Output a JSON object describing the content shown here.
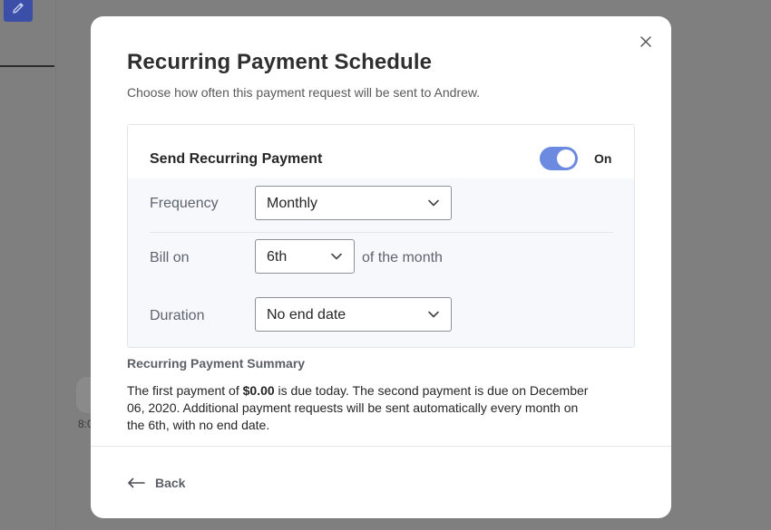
{
  "background": {
    "edit_icon": "pencil-icon",
    "time_fragment": "8:0"
  },
  "modal": {
    "title": "Recurring Payment Schedule",
    "subtitle": "Choose how often this payment request will be sent to Andrew.",
    "close_icon": "close-icon",
    "recurring": {
      "label": "Send Recurring Payment",
      "toggle_on": true,
      "toggle_state_label": "On",
      "accent_color": "#6c8be0"
    },
    "frequency": {
      "label": "Frequency",
      "value": "Monthly"
    },
    "bill_on": {
      "label": "Bill on",
      "value": "6th",
      "suffix": "of the month"
    },
    "duration": {
      "label": "Duration",
      "value": "No end date"
    },
    "summary": {
      "title": "Recurring Payment Summary",
      "text_before_amount": "The first payment of ",
      "amount": "$0.00",
      "text_after_amount": " is due today. The second payment is due on December 06, 2020. Additional payment requests will be sent automatically every month on the 6th, with no end date."
    },
    "footer": {
      "back_label": "Back",
      "back_icon": "arrow-left-icon"
    }
  }
}
